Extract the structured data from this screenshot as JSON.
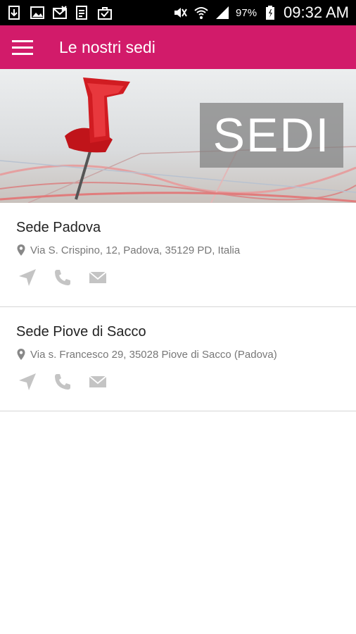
{
  "status_bar": {
    "icons_left": [
      "download-icon",
      "image-icon",
      "missed-call-icon",
      "email-icon",
      "briefcase-icon"
    ],
    "icons_right": [
      "mute-icon",
      "wifi-icon",
      "signal-icon"
    ],
    "battery_percent": "97%",
    "time": "09:32 AM"
  },
  "app_bar": {
    "menu_icon": "hamburger-menu-icon",
    "title": "Le nostri sedi"
  },
  "hero": {
    "label": "SEDI",
    "image": "map-pushpin"
  },
  "sedi": [
    {
      "name": "Sede Padova",
      "address": "Via S. Crispino, 12, Padova, 35129 PD, Italia"
    },
    {
      "name": "Sede Piove di Sacco",
      "address": "Via s. Francesco 29, 35028 Piove di Sacco (Padova)"
    }
  ],
  "colors": {
    "accent": "#d21b6a",
    "icon_gray": "#c4c4c4",
    "text_gray": "#777777"
  }
}
